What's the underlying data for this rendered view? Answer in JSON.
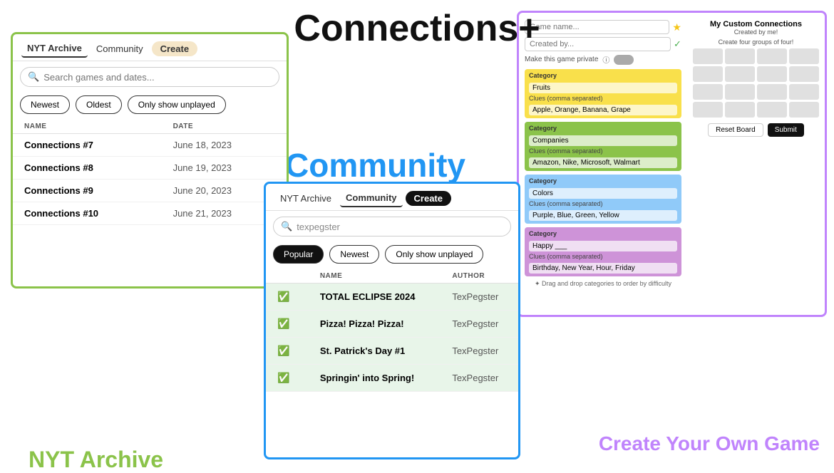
{
  "app": {
    "title": "Connections+"
  },
  "nyt_panel": {
    "label": "NYT Archive",
    "tabs": [
      "NYT Archive",
      "Community",
      "Create"
    ],
    "active_tab": "NYT Archive",
    "search_placeholder": "Search games and dates...",
    "filters": [
      "Newest",
      "Oldest",
      "Only show unplayed"
    ],
    "table_headers": [
      "NAME",
      "DATE"
    ],
    "rows": [
      {
        "name": "Connections #7",
        "date": "June 18, 2023"
      },
      {
        "name": "Connections #8",
        "date": "June 19, 2023"
      },
      {
        "name": "Connections #9",
        "date": "June 20, 2023"
      },
      {
        "name": "Connections #10",
        "date": "June 21, 2023"
      }
    ]
  },
  "community_panel": {
    "label": "Community",
    "tabs": [
      "NYT Archive",
      "Community",
      "Create"
    ],
    "active_tab": "Community",
    "search_value": "texpegster",
    "filters": [
      "Popular",
      "Newest",
      "Only show unplayed"
    ],
    "active_filter": "Popular",
    "table_headers": [
      "NAME",
      "AUTHOR"
    ],
    "rows": [
      {
        "name": "TOTAL ECLIPSE 2024",
        "author": "TexPegster",
        "played": true
      },
      {
        "name": "Pizza! Pizza! Pizza!",
        "author": "TexPegster",
        "played": true
      },
      {
        "name": "St. Patrick's Day #1",
        "author": "TexPegster",
        "played": true
      },
      {
        "name": "Springin' into Spring!",
        "author": "TexPegster",
        "played": true
      }
    ]
  },
  "create_panel": {
    "label": "Create Your Own Game",
    "game_name_placeholder": "Game name...",
    "created_by_placeholder": "Created by...",
    "private_label": "Make this game private",
    "preview_title": "My Custom Connections",
    "preview_created": "Created by me!",
    "preview_subtitle": "Create four groups of four!",
    "categories": [
      {
        "color": "yellow",
        "name_placeholder": "Fruits",
        "clues_label": "Clues (comma separated)",
        "clues_placeholder": "Apple, Orange, Banana, Grape"
      },
      {
        "color": "green",
        "name_placeholder": "Companies",
        "clues_label": "Clues (comma separated)",
        "clues_placeholder": "Amazon, Nike, Microsoft, Walmart"
      },
      {
        "color": "blue",
        "name_placeholder": "Colors",
        "clues_label": "Clues (comma separated)",
        "clues_placeholder": "Purple, Blue, Green, Yellow"
      },
      {
        "color": "purple",
        "name_placeholder": "Happy ___",
        "clues_label": "Clues (comma separated)",
        "clues_placeholder": "Birthday, New Year, Hour, Friday"
      }
    ],
    "reset_label": "Reset Board",
    "submit_label": "Submit",
    "drag_hint": "✦ Drag and drop categories to order by difficulty"
  }
}
